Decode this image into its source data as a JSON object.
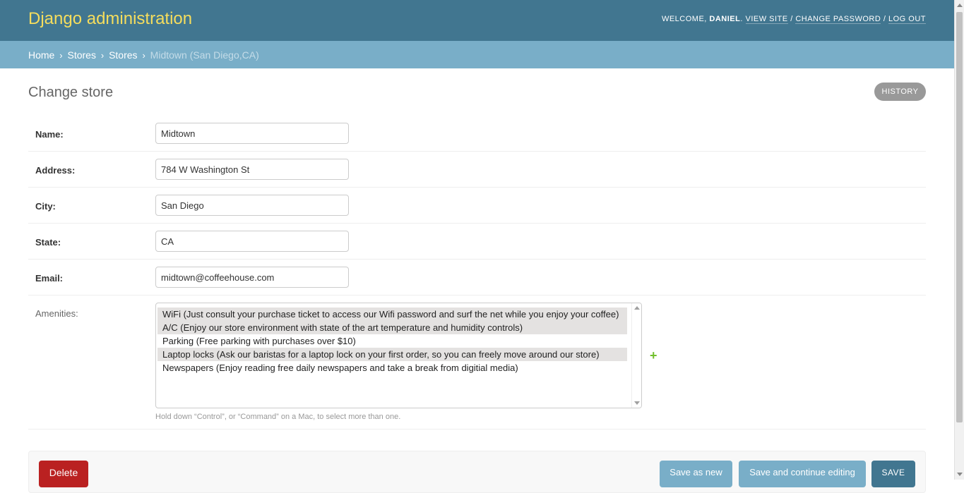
{
  "header": {
    "branding": "Django administration",
    "welcome": "Welcome,",
    "username": "Daniel",
    "view_site": "View site",
    "change_password": "Change password",
    "log_out": "Log out",
    "separator": "/"
  },
  "breadcrumbs": {
    "items": [
      "Home",
      "Stores",
      "Stores"
    ],
    "arrow": "›",
    "current": "Midtown (San Diego,CA)"
  },
  "page": {
    "title": "Change store",
    "history": "HISTORY"
  },
  "form": {
    "name": {
      "label": "Name:",
      "value": "Midtown"
    },
    "address": {
      "label": "Address:",
      "value": "784 W Washington St"
    },
    "city": {
      "label": "City:",
      "value": "San Diego"
    },
    "state": {
      "label": "State:",
      "value": "CA"
    },
    "email": {
      "label": "Email:",
      "value": "midtown@coffeehouse.com"
    },
    "amenities": {
      "label": "Amenities:",
      "add_icon": "+",
      "options": [
        {
          "text": "WiFi (Just consult your purchase ticket to access our Wifi password and surf the net while you enjoy your coffee)",
          "selected": true
        },
        {
          "text": "A/C (Enjoy our store environment with state of the art temperature and humidity controls)",
          "selected": true
        },
        {
          "text": "Parking (Free parking with purchases over $10)",
          "selected": false
        },
        {
          "text": "Laptop locks (Ask our baristas for a laptop lock on your first order, so you can freely move around our store)",
          "selected": true
        },
        {
          "text": "Newspapers (Enjoy reading free daily newspapers and take a break from digitial media)",
          "selected": false
        }
      ],
      "help": "Hold down “Control”, or “Command” on a Mac, to select more than one."
    }
  },
  "submit": {
    "delete": "Delete",
    "save_as_new": "Save as new",
    "save_continue": "Save and continue editing",
    "save": "SAVE"
  },
  "colors": {
    "header_bg": "#417690",
    "breadcrumb_bg": "#79aec8",
    "branding": "#f5dd5d",
    "delete": "#ba2121",
    "add_icon": "#70bf2b"
  }
}
